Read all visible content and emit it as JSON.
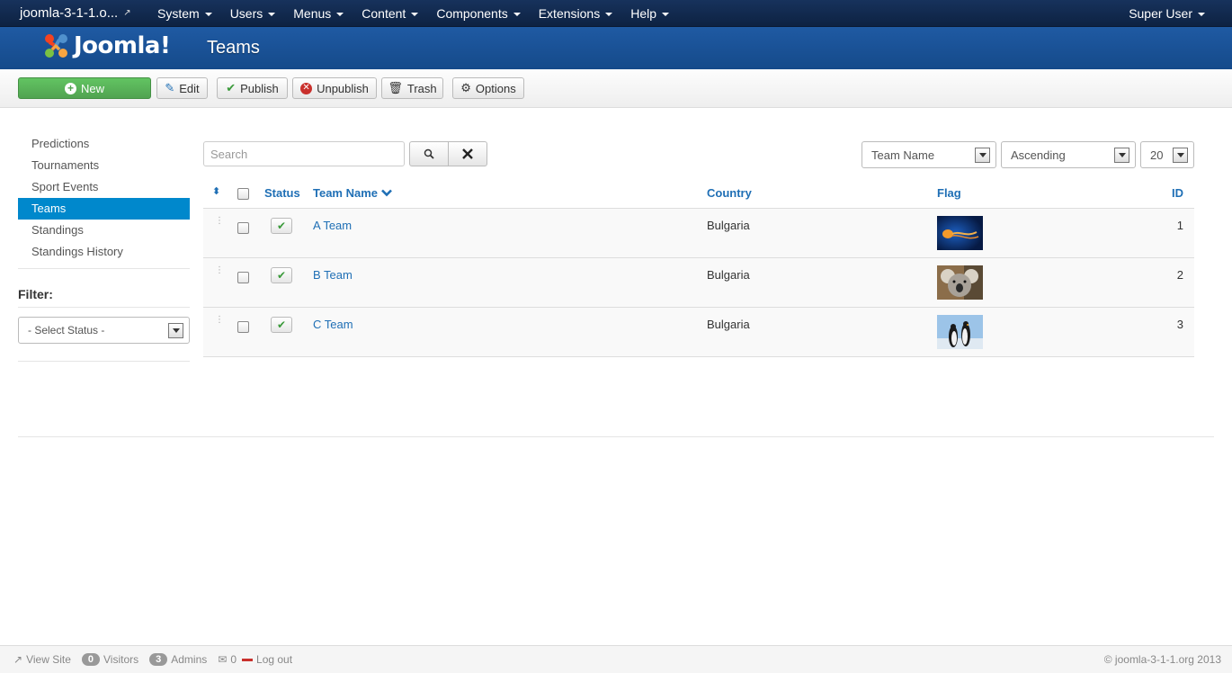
{
  "topnav": {
    "site_name": "joomla-3-1-1.o...",
    "menus": [
      "System",
      "Users",
      "Menus",
      "Content",
      "Components",
      "Extensions",
      "Help"
    ],
    "user": "Super User"
  },
  "header": {
    "logo_text": "Joomla!",
    "title": "Teams"
  },
  "toolbar": {
    "new": "New",
    "edit": "Edit",
    "publish": "Publish",
    "unpublish": "Unpublish",
    "trash": "Trash",
    "options": "Options"
  },
  "sidebar": {
    "items": [
      "Predictions",
      "Tournaments",
      "Sport Events",
      "Teams",
      "Standings",
      "Standings History"
    ],
    "active": "Teams",
    "filter_label": "Filter:",
    "status_select": "- Select Status -"
  },
  "search": {
    "placeholder": "Search"
  },
  "sorting": {
    "order_by": "Team Name",
    "direction": "Ascending",
    "limit": "20"
  },
  "table": {
    "headers": {
      "status": "Status",
      "team_name": "Team Name",
      "country": "Country",
      "flag": "Flag",
      "id": "ID"
    },
    "rows": [
      {
        "name": "A Team",
        "country": "Bulgaria",
        "flag": "jellyfish-image",
        "id": "1"
      },
      {
        "name": "B Team",
        "country": "Bulgaria",
        "flag": "koala-image",
        "id": "2"
      },
      {
        "name": "C Team",
        "country": "Bulgaria",
        "flag": "penguins-image",
        "id": "3"
      }
    ]
  },
  "footer": {
    "view_site": "View Site",
    "visitors_count": "0",
    "visitors": "Visitors",
    "admins_count": "3",
    "admins": "Admins",
    "messages_count": "0",
    "logout": "Log out",
    "copyright": "© joomla-3-1-1.org 2013"
  },
  "colors": {
    "topnav": "#17325c",
    "header": "#1f5aa3",
    "link": "#1f6fb5",
    "active": "#0088cc",
    "new_button": "#51a351"
  }
}
